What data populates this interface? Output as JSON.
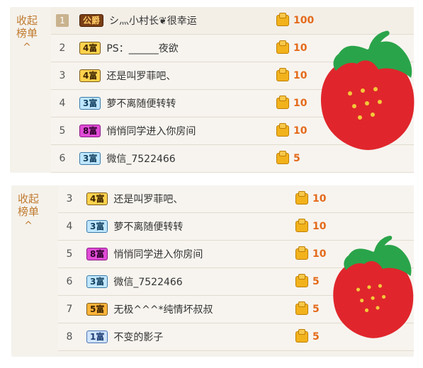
{
  "panel1": {
    "collapse": {
      "line1": "收起",
      "line2": "榜单",
      "caret": "^"
    },
    "rows": [
      {
        "rank": "1",
        "badge": "公爵",
        "name": "シ灬小村长❦很幸运",
        "coins": "100",
        "badge_style": "gong"
      },
      {
        "rank": "2",
        "badge": "4富",
        "name": "PS：______夜欲",
        "coins": "10",
        "badge_style": "4"
      },
      {
        "rank": "3",
        "badge": "4富",
        "name": "还是叫罗菲吧、",
        "coins": "10",
        "badge_style": "4"
      },
      {
        "rank": "4",
        "badge": "3富",
        "name": "萝不离随便转转",
        "coins": "10",
        "badge_style": "3"
      },
      {
        "rank": "5",
        "badge": "8富",
        "name": "悄悄同学进入你房间",
        "coins": "10",
        "badge_style": "8"
      },
      {
        "rank": "6",
        "badge": "3富",
        "name": "微信_7522466",
        "coins": "5",
        "badge_style": "3"
      }
    ]
  },
  "panel2": {
    "collapse": {
      "line1": "收起",
      "line2": "榜单",
      "caret": "^"
    },
    "rows": [
      {
        "rank": "3",
        "badge": "4富",
        "name": "还是叫罗菲吧、",
        "coins": "10",
        "badge_style": "4"
      },
      {
        "rank": "4",
        "badge": "3富",
        "name": "萝不离随便转转",
        "coins": "10",
        "badge_style": "3"
      },
      {
        "rank": "5",
        "badge": "8富",
        "name": "悄悄同学进入你房间",
        "coins": "10",
        "badge_style": "8"
      },
      {
        "rank": "6",
        "badge": "3富",
        "name": "微信_7522466",
        "coins": "5",
        "badge_style": "3"
      },
      {
        "rank": "7",
        "badge": "5富",
        "name": "无极^^^*纯情坏叔叔",
        "coins": "5",
        "badge_style": "5"
      },
      {
        "rank": "8",
        "badge": "1富",
        "name": "不变的影子",
        "coins": "5",
        "badge_style": "1"
      }
    ]
  },
  "icons": {
    "coin": "gold-coin-stack-icon",
    "overlay": "strawberry-icon"
  },
  "colors": {
    "accent": "#c07a2e",
    "coin_text": "#e46a1b",
    "strawberry": "#e0262c",
    "leaf": "#2aa44a"
  }
}
